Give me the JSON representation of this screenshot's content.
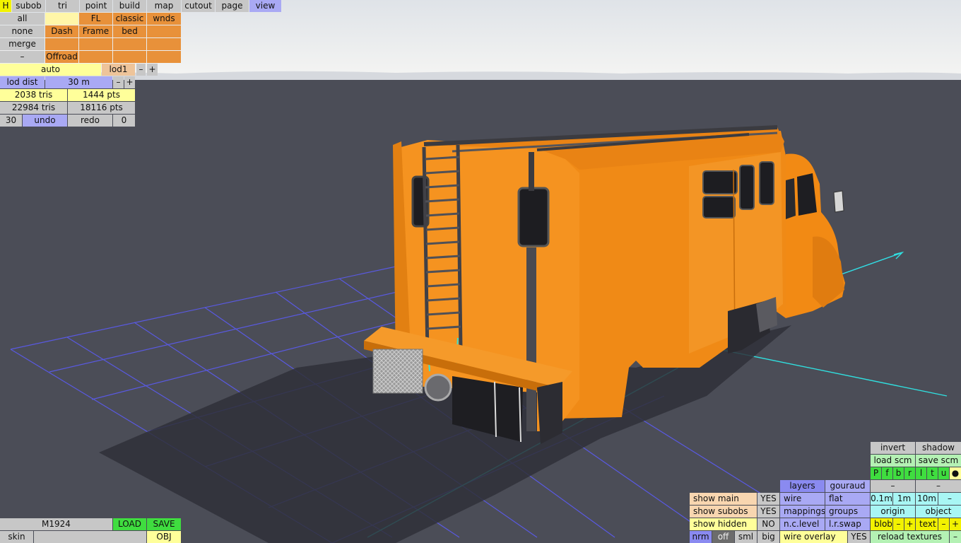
{
  "top_menu": [
    "H",
    "subob",
    "tri",
    "point",
    "build",
    "map",
    "cutout",
    "page",
    "view"
  ],
  "parts_grid": {
    "rows": [
      [
        "all",
        "",
        "FL",
        "classic",
        "wnds"
      ],
      [
        "none",
        "Dash",
        "Frame",
        "bed",
        ""
      ],
      [
        "merge",
        "",
        "",
        "",
        ""
      ],
      [
        "–",
        "Offroad",
        "",
        "",
        ""
      ]
    ]
  },
  "lod": {
    "mode": "auto",
    "level": "lod1",
    "minus": "–",
    "plus": "+"
  },
  "lod_dist": {
    "label": "lod dist",
    "value": "30 m",
    "minus": "–",
    "plus": "+"
  },
  "stats": {
    "tris_lod": "2038 tris",
    "pts_lod": "1444 pts",
    "tris_total": "22984 tris",
    "pts_total": "18116 pts"
  },
  "history": {
    "undo_count": "30",
    "undo": "undo",
    "redo": "redo",
    "redo_count": "0"
  },
  "file": {
    "name": "M1924",
    "load": "LOAD",
    "save": "SAVE",
    "skin": "skin",
    "skin_value": "",
    "obj": "OBJ"
  },
  "view_panel": {
    "invert": "invert",
    "shadow": "shadow",
    "load_scm": "load scm",
    "save_scm": "save scm",
    "view_dirs": [
      "P",
      "f",
      "b",
      "r",
      "l",
      "t",
      "u",
      "●"
    ],
    "dash1": "–",
    "dash2": "–",
    "layers": "layers",
    "gouraud": "gouraud",
    "show_main": "show main",
    "show_main_val": "YES",
    "wire": "wire",
    "flat": "flat",
    "scale_01": "0.1m",
    "scale_1": "1m",
    "scale_10": "10m",
    "scale_minus": "–",
    "show_subobs": "show subobs",
    "show_subobs_val": "YES",
    "mappings": "mappings",
    "groups": "groups",
    "origin": "origin",
    "object": "object",
    "show_hidden": "show hidden",
    "show_hidden_val": "NO",
    "nc_level": "n.c.level",
    "lr_swap": "l.r.swap",
    "blob": "blob",
    "blob_minus": "–",
    "blob_plus": "+",
    "text": "text",
    "text_minus": "–",
    "text_plus": "+",
    "nrm": "nrm",
    "off": "off",
    "sml": "sml",
    "big": "big",
    "wire_overlay": "wire overlay",
    "wire_overlay_val": "YES",
    "reload_textures": "reload textures",
    "reload_minus": "–"
  },
  "colors": {
    "sky": "#eef0f2",
    "floor": "#4b4d57",
    "truck_orange": "#f28a14",
    "grid": "#5b5bf0",
    "axis": "#30e0e0"
  }
}
